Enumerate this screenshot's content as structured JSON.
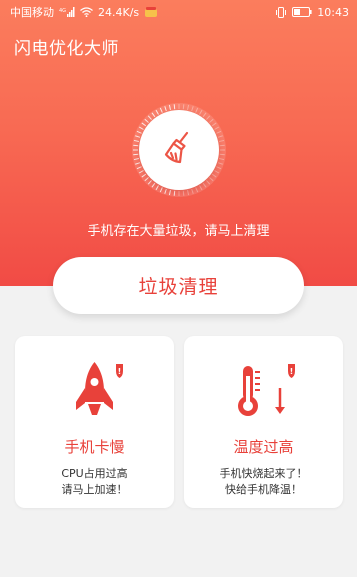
{
  "status_bar": {
    "carrier": "中国移动",
    "net_speed": "24.4K/s",
    "time": "10:43"
  },
  "app": {
    "title": "闪电优化大师"
  },
  "hero": {
    "message": "手机存在大量垃圾，请马上清理",
    "clean_button": "垃圾清理"
  },
  "cards": [
    {
      "title": "手机卡慢",
      "desc_line1": "CPU占用过高",
      "desc_line2": "请马上加速！",
      "icon": "rocket-icon"
    },
    {
      "title": "温度过高",
      "desc_line1": "手机快烧起来了！",
      "desc_line2": "快给手机降温！",
      "icon": "thermometer-icon"
    }
  ],
  "colors": {
    "accent": "#e8413a",
    "hero_top": "#fb7d5d",
    "hero_bottom": "#f14b45"
  }
}
